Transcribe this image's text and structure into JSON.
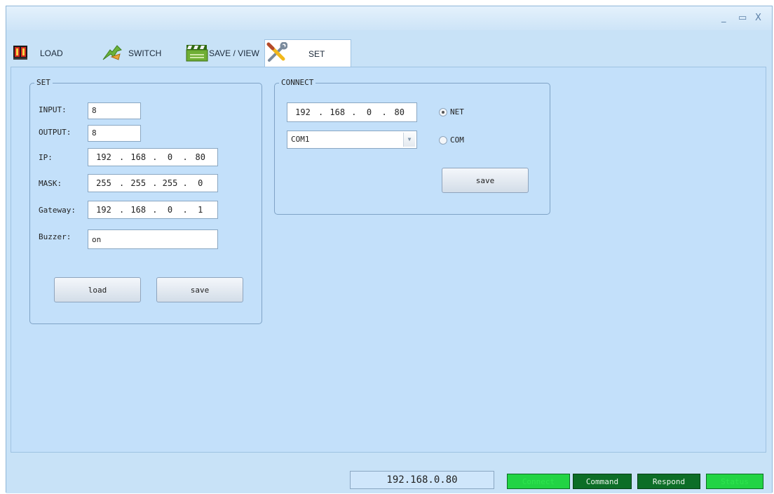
{
  "window": {
    "minimize": "_",
    "maximize": "▭",
    "close": "X"
  },
  "tabs": [
    {
      "label": "LOAD",
      "icon": "matrix-display-icon"
    },
    {
      "label": "SWITCH",
      "icon": "switch-arrows-icon"
    },
    {
      "label": "SAVE / VIEW",
      "icon": "clapperboard-icon"
    },
    {
      "label": "SET",
      "icon": "wrench-tools-icon"
    }
  ],
  "set_group": {
    "title": "SET",
    "input_label": "INPUT:",
    "input_value": "8",
    "output_label": "OUTPUT:",
    "output_value": "8",
    "ip_label": "IP:",
    "ip": [
      "192",
      "168",
      "0",
      "80"
    ],
    "mask_label": "MASK:",
    "mask": [
      "255",
      "255",
      "255",
      "0"
    ],
    "gateway_label": "Gateway:",
    "gateway": [
      "192",
      "168",
      "0",
      "1"
    ],
    "buzzer_label": "Buzzer:",
    "buzzer_value": "on",
    "load_button": "load",
    "save_button": "save"
  },
  "connect_group": {
    "title": "CONNECT",
    "ip": [
      "192",
      "168",
      "0",
      "80"
    ],
    "com_port": "COM1",
    "net_label": "NET",
    "com_label": "COM",
    "net_selected": true,
    "save_button": "save"
  },
  "statusbar": {
    "ip": "192.168.0.80",
    "connect": "Connect",
    "command": "Command",
    "respond": "Respond",
    "status": "Status"
  },
  "colors": {
    "connect_bg": "#22d444",
    "command_bg": "#0d6e27",
    "status_bg": "#22d444"
  }
}
